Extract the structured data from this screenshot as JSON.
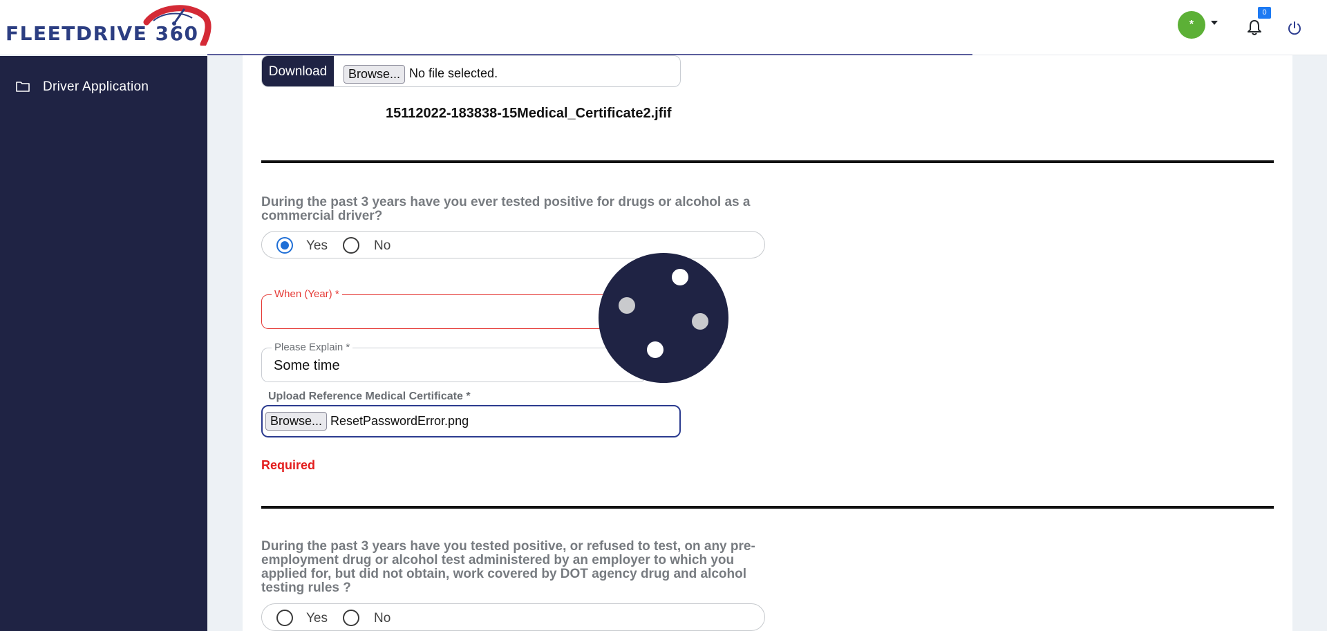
{
  "app": {
    "logo_text": "FLEETDRIVE 360",
    "brand_colors": {
      "navy": "#1f2344",
      "logo_blue": "#2c3e82",
      "logo_red": "#d42a36"
    }
  },
  "header": {
    "avatar_initial": "*",
    "avatar_color": "#5cb036",
    "notification_count": "0",
    "icons": [
      "bell-icon",
      "power-icon",
      "chevron-down-icon"
    ]
  },
  "sidebar": {
    "items": [
      {
        "label": "Driver Application",
        "icon": "folder-icon"
      }
    ]
  },
  "upload_top": {
    "download_label": "Download",
    "browse_label": "Browse...",
    "file_status": "No file selected.",
    "existing_file": "15112022-183838-15Medical_Certificate2.jfif"
  },
  "question1": {
    "text": "During the past 3 years have you ever tested positive for drugs or alcohol as a commercial driver?",
    "options": [
      "Yes",
      "No"
    ],
    "selected": "Yes"
  },
  "when_field": {
    "label": "When (Year) *",
    "value": ""
  },
  "explain_field": {
    "label": "Please Explain *",
    "value": "Some time"
  },
  "medical_upload": {
    "label": "Upload Reference Medical Certificate *",
    "browse_label": "Browse...",
    "file_name": "ResetPasswordError.png",
    "error": "Required"
  },
  "question2": {
    "text": "During the past 3 years have you tested positive, or refused to test, on any pre-employment drug or alcohol test administered by an employer to which you applied for, but did not obtain, work covered by DOT agency drug and alcohol testing rules ?",
    "options": [
      "Yes",
      "No"
    ],
    "selected": ""
  }
}
